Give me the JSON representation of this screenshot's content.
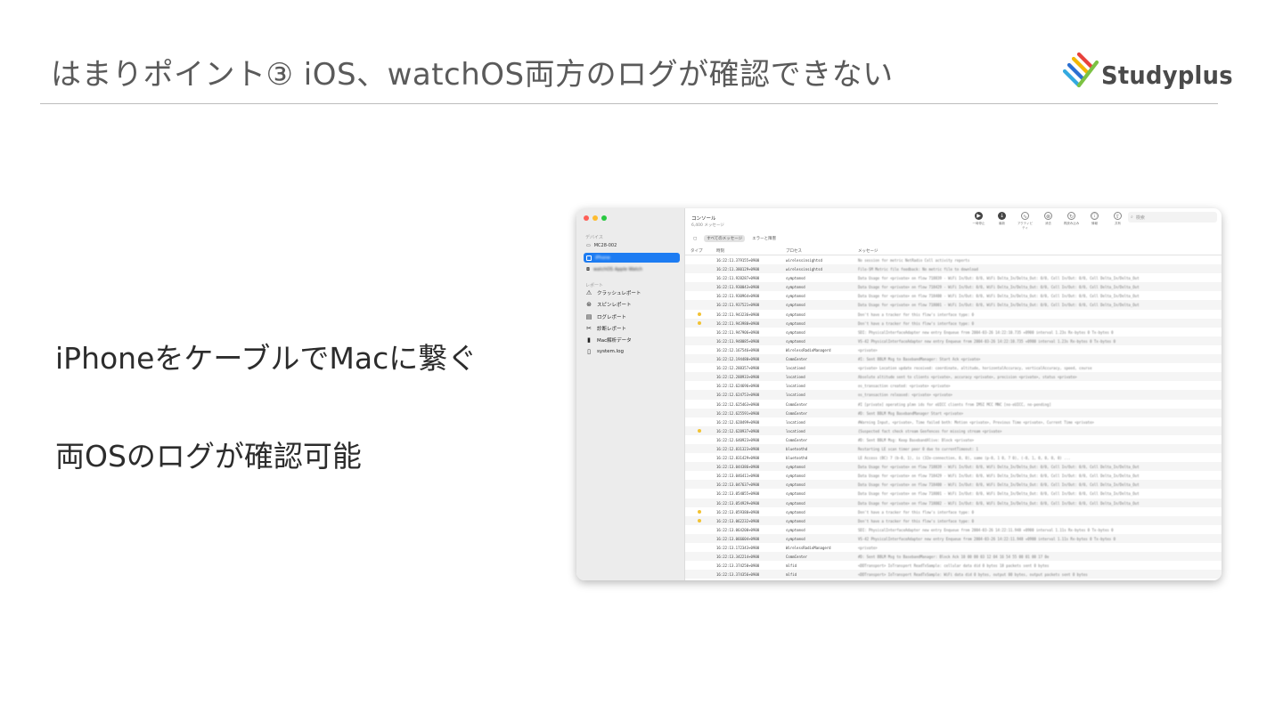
{
  "slide": {
    "title": "はまりポイント③  iOS、watchOS両方のログが確認できない",
    "brand": "Studyplus",
    "points": [
      "iPhoneをケーブルでMacに繋ぐ",
      "両OSのログが確認可能"
    ]
  },
  "console": {
    "title": "コンソール",
    "subtitle": "6,400 メッセージ",
    "sidebar": {
      "devices_label": "デバイス",
      "devices": [
        "MC28-002",
        "iPhone",
        "watchOS Apple Watch"
      ],
      "reports_label": "レポート",
      "reports": [
        {
          "label": "クラッシュレポート",
          "icon": "warning-icon"
        },
        {
          "label": "スピンレポート",
          "icon": "spin-icon"
        },
        {
          "label": "ログレポート",
          "icon": "document-icon"
        },
        {
          "label": "診断レポート",
          "icon": "tools-icon"
        },
        {
          "label": "Mac解析データ",
          "icon": "chart-icon"
        },
        {
          "label": "system.log",
          "icon": "file-icon"
        }
      ]
    },
    "toolbar": {
      "buttons": [
        {
          "label": "一時停止",
          "icon": "pause-icon",
          "glyph": "▶"
        },
        {
          "label": "最新",
          "icon": "arrow-down-icon",
          "glyph": "↓"
        },
        {
          "label": "アクティビティ",
          "icon": "activity-icon",
          "glyph": "∿"
        },
        {
          "label": "消去",
          "icon": "clear-icon",
          "glyph": "⊗"
        },
        {
          "label": "再読み込み",
          "icon": "reload-icon",
          "glyph": "↻"
        },
        {
          "label": "情報",
          "icon": "info-icon",
          "glyph": "ⓘ"
        },
        {
          "label": "共有",
          "icon": "share-icon",
          "glyph": "⇧"
        }
      ],
      "search_placeholder": "検索"
    },
    "filters": [
      "すべてのメッセージ",
      "エラーと障害"
    ],
    "columns": [
      "タイプ",
      "時刻",
      "プロセス",
      "メッセージ"
    ],
    "rows": [
      {
        "time": "16:22:11.379155+0900",
        "process": "wirelessinsightsd",
        "msg": "No session for metric NetRadio Cell activity reports",
        "warn": false
      },
      {
        "time": "16:22:11.380129+0900",
        "process": "wirelessinsightsd",
        "msg": "File-SM Metric file feedback: No metric file to download",
        "warn": false
      },
      {
        "time": "16:22:11.928287+0900",
        "process": "symptomsd",
        "msg": "Data Usage for <private> on flow 718839 - WiFi In/Out: 0/0, WiFi Delta_In/Delta_Out: 0/0, Cell In/Out: 0/0, Cell Delta_In/Delta_Out",
        "warn": false
      },
      {
        "time": "16:22:11.930043+0900",
        "process": "symptomsd",
        "msg": "Data Usage for <private> on flow 718429 - WiFi In/Out: 0/0, WiFi Delta_In/Delta_Out: 0/0, Cell In/Out: 0/0, Cell Delta_In/Delta_Out",
        "warn": false
      },
      {
        "time": "16:22:11.930964+0900",
        "process": "symptomsd",
        "msg": "Data Usage for <private> on flow 718400 - WiFi In/Out: 0/0, WiFi Delta_In/Delta_Out: 0/0, Cell In/Out: 0/0, Cell Delta_In/Delta_Out",
        "warn": false
      },
      {
        "time": "16:22:11.937521+0900",
        "process": "symptomsd",
        "msg": "Data Usage for <private> on flow 718001 - WiFi In/Out: 0/0, WiFi Delta_In/Delta_Out: 0/0, Cell In/Out: 0/0, Cell Delta_In/Delta_Out",
        "warn": false
      },
      {
        "time": "16:22:11.943236+0900",
        "process": "symptomsd",
        "msg": "Don't have a tracker for this flow's interface type: 0",
        "warn": true
      },
      {
        "time": "16:22:11.943980+0900",
        "process": "symptomsd",
        "msg": "Don't have a tracker for this flow's interface type: 0",
        "warn": true
      },
      {
        "time": "16:22:11.947906+0900",
        "process": "symptomsd",
        "msg": "SDI: PhysicalInterfaceAdapter new entry Enqueue from 2004-03-26 14:22:10.735 +0900 interval 1.23s Rx-bytes 0 Tx-bytes 0",
        "warn": false
      },
      {
        "time": "16:22:11.948085+0900",
        "process": "symptomsd",
        "msg": "VS-42 PhysicalInterfaceAdapter new entry Enqueue from 2004-03-26 14:22:10.735 +0900 interval 1.23s Rx-bytes 0 Tx-bytes 0",
        "warn": false
      },
      {
        "time": "16:22:12.167546+0900",
        "process": "WirelessRadioManagerd",
        "msg": "<private>",
        "warn": false
      },
      {
        "time": "16:22:12.194480+0900",
        "process": "CommCenter",
        "msg": "#I: Sent BBLM Msg to BasebandManager: Start Ack <private>",
        "warn": false
      },
      {
        "time": "16:22:12.288357+0900",
        "process": "locationd",
        "msg": "<private> Location update received: coordinate, altitude, horizontalAccuracy, verticalAccuracy, speed, course",
        "warn": false
      },
      {
        "time": "16:22:12.288933+0900",
        "process": "locationd",
        "msg": "Absolute altitude sent to clients <private>, accuracy <private>, precision <private>, status <private>",
        "warn": false
      },
      {
        "time": "16:22:12.624696+0900",
        "process": "locationd",
        "msg": "os_transaction created: <private> <private>",
        "warn": false
      },
      {
        "time": "16:22:12.624753+0900",
        "process": "locationd",
        "msg": "os_transaction released: <private> <private>",
        "warn": false
      },
      {
        "time": "16:22:12.625463+0900",
        "process": "CommCenter",
        "msg": "#I [private] operating plmn ids for eUICC clients from IMSI MCC MNC [no-eUICC, no-pending]",
        "warn": false
      },
      {
        "time": "16:22:12.625591+0900",
        "process": "CommCenter",
        "msg": "#D: Sent BBLM Msg BasebandManager Start <private>",
        "warn": false
      },
      {
        "time": "16:22:12.628499+0900",
        "process": "locationd",
        "msg": "#Warning Input, <private>, Time failed both: Motion <private>, Previous Time <private>, Current Time <private>",
        "warn": false
      },
      {
        "time": "16:22:12.628937+0900",
        "process": "locationd",
        "msg": "{Suspected fact check stream Geofences for missing stream <private>",
        "warn": true
      },
      {
        "time": "16:22:12.640923+0900",
        "process": "CommCenter",
        "msg": "#D: Sent BBLM Msg: Keep BasebandAlive: Block <private>",
        "warn": false
      },
      {
        "time": "16:22:12.831323+0900",
        "process": "bluetoothd",
        "msg": "Restarting LE scan timer peer 0 due to currentTimeout: 1",
        "warn": false
      },
      {
        "time": "16:22:12.831429+0900",
        "process": "bluetoothd",
        "msg": "LE Access (BC) 7 (b-0, 1), is (32e-connection, 0, 0), same (p-0, 1 0, 7 0), (-0, 1, 0, 0, 0, 0) ...",
        "warn": false
      },
      {
        "time": "16:22:13.044386+0900",
        "process": "symptomsd",
        "msg": "Data Usage for <private> on flow 718839 - WiFi In/Out: 0/0, WiFi Delta_In/Delta_Out: 0/0, Cell In/Out: 0/0, Cell Delta_In/Delta_Out",
        "warn": false
      },
      {
        "time": "16:22:13.046411+0900",
        "process": "symptomsd",
        "msg": "Data Usage for <private> on flow 718429 - WiFi In/Out: 0/0, WiFi Delta_In/Delta_Out: 0/0, Cell In/Out: 0/0, Cell Delta_In/Delta_Out",
        "warn": false
      },
      {
        "time": "16:22:13.047637+0900",
        "process": "symptomsd",
        "msg": "Data Usage for <private> on flow 718400 - WiFi In/Out: 0/0, WiFi Delta_In/Delta_Out: 0/0, Cell In/Out: 0/0, Cell Delta_In/Delta_Out",
        "warn": false
      },
      {
        "time": "16:22:13.054055+0900",
        "process": "symptomsd",
        "msg": "Data Usage for <private> on flow 718001 - WiFi In/Out: 0/0, WiFi Delta_In/Delta_Out: 0/0, Cell In/Out: 0/0, Cell Delta_In/Delta_Out",
        "warn": false
      },
      {
        "time": "16:22:13.054929+0900",
        "process": "symptomsd",
        "msg": "Data Usage for <private> on flow 718002 - WiFi In/Out: 0/0, WiFi Delta_In/Delta_Out: 0/0, Cell In/Out: 0/0, Cell Delta_In/Delta_Out",
        "warn": false
      },
      {
        "time": "16:22:13.059380+0900",
        "process": "symptomsd",
        "msg": "Don't have a tracker for this flow's interface type: 0",
        "warn": true
      },
      {
        "time": "16:22:13.062232+0900",
        "process": "symptomsd",
        "msg": "Don't have a tracker for this flow's interface type: 0",
        "warn": true
      },
      {
        "time": "16:22:13.064200+0900",
        "process": "symptomsd",
        "msg": "SDI: PhysicalInterfaceAdapter new entry Enqueue from 2004-03-26 14:22:11.948 +0900 interval 1.11s Rx-bytes 0 Tx-bytes 0",
        "warn": false
      },
      {
        "time": "16:22:13.066604+0900",
        "process": "symptomsd",
        "msg": "VS-42 PhysicalInterfaceAdapter new entry Enqueue from 2004-03-26 14:22:11.948 +0900 interval 1.11s Rx-bytes 0 Tx-bytes 0",
        "warn": false
      },
      {
        "time": "16:22:13.172343+0900",
        "process": "WirelessRadioManagerd",
        "msg": "<private>",
        "warn": false
      },
      {
        "time": "16:22:13.342214+0900",
        "process": "CommCenter",
        "msg": "#D: Sent BBLM Msg to BasebandManager: Block Ack 10 00 00 03 12 04 16 54 55 00 01 00 17 0e",
        "warn": false
      },
      {
        "time": "16:22:13.374250+0900",
        "process": "mlfid",
        "msg": "<DDTransport> IoTransport ReadTxSample: cellular data did 0 bytes 18 packets sent 0 bytes",
        "warn": false
      },
      {
        "time": "16:22:13.374356+0900",
        "process": "mlfid",
        "msg": "<DDTransport> IoTransport ReadTxSample: WiFi data did 0 bytes, output 00 bytes, output packets sent 0 bytes",
        "warn": false
      }
    ]
  }
}
